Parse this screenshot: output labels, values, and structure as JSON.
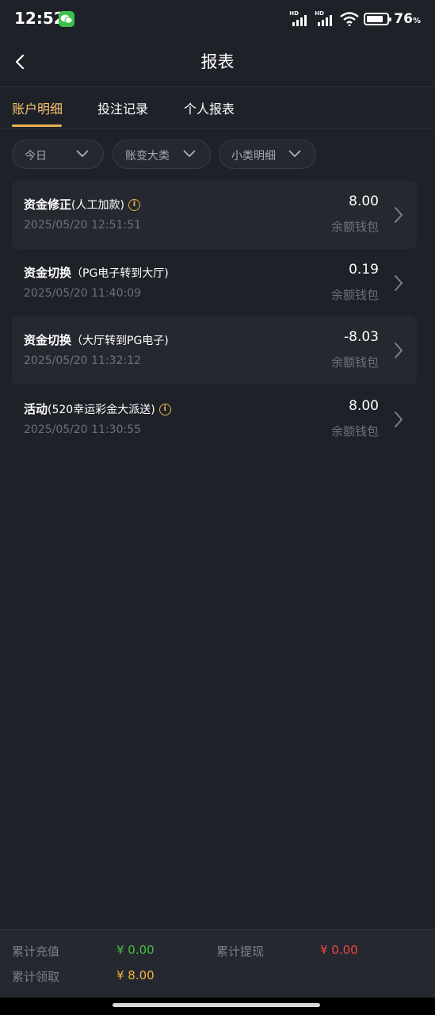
{
  "status_bar": {
    "time": "12:52",
    "battery_percent": "76",
    "battery_unit": "%",
    "signal_label": "HD",
    "icons": [
      "wechat-icon",
      "signal-icon",
      "wifi-icon",
      "battery-icon"
    ]
  },
  "header": {
    "title": "报表"
  },
  "tabs": [
    {
      "label": "账户明细",
      "active": true
    },
    {
      "label": "投注记录",
      "active": false
    },
    {
      "label": "个人报表",
      "active": false
    }
  ],
  "filters": [
    {
      "label": "今日"
    },
    {
      "label": "账变大类"
    },
    {
      "label": "小类明细"
    }
  ],
  "records": [
    {
      "name": "资金修正",
      "detail": "(人工加款)",
      "info": true,
      "time": "2025/05/20 12:51:51",
      "amount": "8.00",
      "wallet": "余额钱包"
    },
    {
      "name": "资金切换",
      "detail": "（PG电子转到大厅)",
      "info": false,
      "time": "2025/05/20 11:40:09",
      "amount": "0.19",
      "wallet": "余额钱包"
    },
    {
      "name": "资金切换",
      "detail": "（大厅转到PG电子)",
      "info": false,
      "time": "2025/05/20 11:32:12",
      "amount": "-8.03",
      "wallet": "余额钱包"
    },
    {
      "name": "活动",
      "detail": "(520幸运彩金大派送)",
      "info": true,
      "time": "2025/05/20 11:30:55",
      "amount": "8.00",
      "wallet": "余额钱包"
    }
  ],
  "info_glyph": "i",
  "footer": {
    "recharge_label": "累计充值",
    "recharge_value": "¥ 0.00",
    "withdraw_label": "累计提现",
    "withdraw_value": "¥ 0.00",
    "claim_label": "累计领取",
    "claim_value": "¥ 8.00"
  },
  "colors": {
    "accent": "#e9b04f",
    "recharge": "#3fc23a",
    "withdraw": "#e9483f",
    "claim": "#f0b53f"
  }
}
